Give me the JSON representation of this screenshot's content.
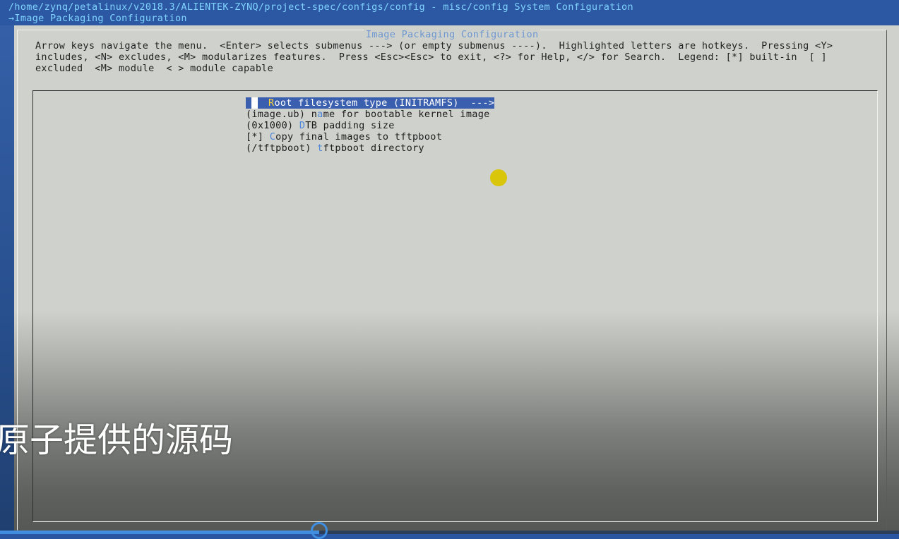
{
  "window": {
    "path_title": "/home/zynq/petalinux/v2018.3/ALIENTEK-ZYNQ/project-spec/configs/config - misc/config System Configuration",
    "breadcrumb": "→Image Packaging Configuration"
  },
  "dialog": {
    "title": "Image Packaging Configuration",
    "help_text": "Arrow keys navigate the menu.  <Enter> selects submenus ---> (or empty submenus ----).  Highlighted letters are hotkeys.  Pressing <Y>\nincludes, <N> excludes, <M> modularizes features.  Press <Esc><Esc> to exit, <?> for Help, </> for Search.  Legend: [*] built-in  [ ]\nexcluded  <M> module  < > module capable"
  },
  "menu": {
    "items": [
      {
        "prefix": "",
        "hotkey": "R",
        "rest": "oot filesystem type (INITRAMFS)  --->"
      },
      {
        "prefix": "(image.ub) ",
        "hotkey_pre": "n",
        "hotkey": "a",
        "rest": "me for bootable kernel image"
      },
      {
        "prefix": "(0x1000) ",
        "hotkey": "D",
        "rest": "TB padding size"
      },
      {
        "prefix": "[*] ",
        "hotkey": "C",
        "rest": "opy final images to tftpboot"
      },
      {
        "prefix": "(/tftpboot) ",
        "hotkey": "t",
        "rest": "ftpboot directory"
      }
    ]
  },
  "overlay": {
    "subtitle": "原子提供的源码"
  },
  "video": {
    "progress": 0.355,
    "accent": "#3f8ee0"
  }
}
